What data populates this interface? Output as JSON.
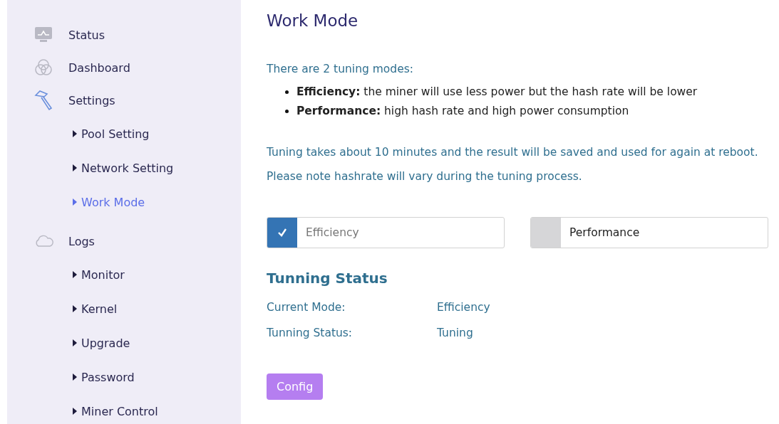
{
  "sidebar": {
    "items": [
      {
        "label": "Status"
      },
      {
        "label": "Dashboard"
      },
      {
        "label": "Settings",
        "children": [
          {
            "label": "Pool Setting",
            "selected": false
          },
          {
            "label": "Network Setting",
            "selected": false
          },
          {
            "label": "Work Mode",
            "selected": true
          }
        ]
      },
      {
        "label": "Logs",
        "children": [
          {
            "label": "Monitor",
            "selected": false
          },
          {
            "label": "Kernel",
            "selected": false
          },
          {
            "label": "Upgrade",
            "selected": false
          },
          {
            "label": "Password",
            "selected": false
          },
          {
            "label": "Miner Control",
            "selected": false
          }
        ]
      }
    ]
  },
  "page": {
    "title": "Work Mode",
    "intro": "There are 2 tuning modes:",
    "bullets": [
      "**Efficiency:** the miner will use less power but the hash rate will be lower",
      "**Performance:** high hash rate and high power consumption"
    ],
    "notes": [
      "Tuning takes about 10 minutes and the result will be saved and used for again at reboot.",
      "Please note hashrate will vary during the tuning process."
    ],
    "modes": [
      {
        "label": "Efficiency",
        "selected": true
      },
      {
        "label": "Performance",
        "selected": false
      }
    ],
    "status_title": "Tunning Status",
    "status_rows": [
      {
        "label": "Current Mode:",
        "value": "Efficiency"
      },
      {
        "label": "Tunning Status:",
        "value": "Tuning"
      }
    ],
    "button": "Config"
  }
}
